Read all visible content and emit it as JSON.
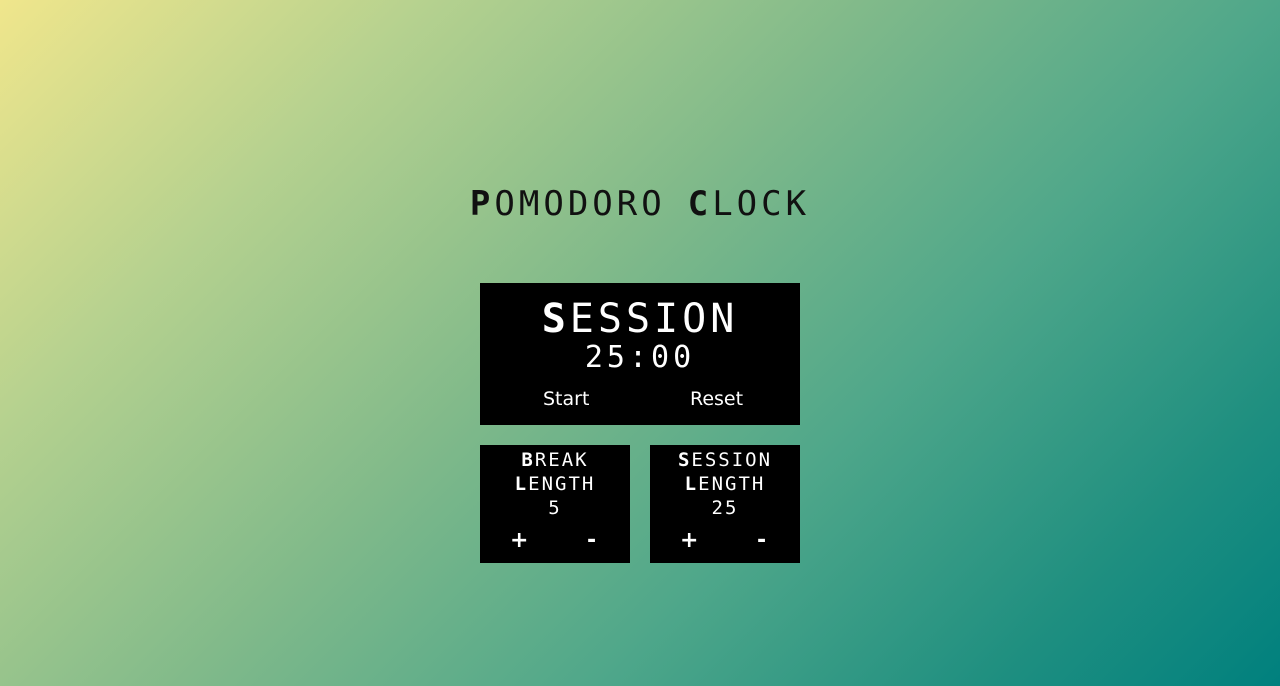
{
  "title": {
    "word1_initial": "P",
    "word1_rest": "OMODORO",
    "word2_initial": "C",
    "word2_rest": "LOCK"
  },
  "session_panel": {
    "title_initial": "S",
    "title_rest": "ESSION",
    "time": "25:00",
    "start_label": "Start",
    "reset_label": "Reset"
  },
  "break_length": {
    "line1_initial": "B",
    "line1_rest": "REAK",
    "line2_initial": "L",
    "line2_rest": "ENGTH",
    "value": "5",
    "plus_label": "+",
    "minus_label": "-"
  },
  "session_length": {
    "line1_initial": "S",
    "line1_rest": "ESSION",
    "line2_initial": "L",
    "line2_rest": "ENGTH",
    "value": "25",
    "plus_label": "+",
    "minus_label": "-"
  },
  "colors": {
    "gradient_start": "#f0e68c",
    "gradient_end": "#00807e",
    "panel_bg": "#000000",
    "panel_text": "#ffffff"
  }
}
